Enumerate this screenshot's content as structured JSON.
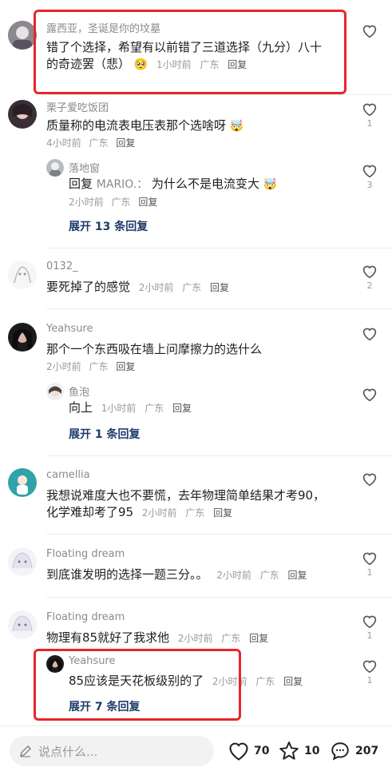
{
  "comments": [
    {
      "name": "露西亚，圣诞是你的坟墓",
      "text1": "错了个选择，希望有以前错了三道选择（九分）八十",
      "text2": "的奇迹罢（悲）",
      "emoji": "🥺",
      "time": "1小时前",
      "loc": "广东",
      "reply": "回复",
      "likes": ""
    },
    {
      "name": "栗子爱吃饭团",
      "text1": "质量称的电流表电压表那个选啥呀",
      "emoji": "🤯",
      "time": "4小时前",
      "loc": "广东",
      "reply": "回复",
      "likes": "1",
      "sub": {
        "name": "落地窗",
        "prefix": "回复",
        "target": "MARIO.：",
        "text": "为什么不是电流变大",
        "emoji": "🤯",
        "time": "2小时前",
        "loc": "广东",
        "reply": "回复",
        "likes": "3"
      },
      "expand": "展开 13 条回复"
    },
    {
      "name": "0132_",
      "text1": "要死掉了的感觉",
      "time": "2小时前",
      "loc": "广东",
      "reply": "回复",
      "likes": "2"
    },
    {
      "name": "Yeahsure",
      "text1": "那个一个东西吸在墙上问摩擦力的选什么",
      "time": "2小时前",
      "loc": "广东",
      "reply": "回复",
      "likes": "",
      "sub": {
        "name": "鱼泡",
        "text": "向上",
        "time": "1小时前",
        "loc": "广东",
        "reply": "回复",
        "likes": ""
      },
      "expand": "展开 1 条回复"
    },
    {
      "name": "camellia",
      "text1": "我想说难度大也不要慌，去年物理简单结果才考90，",
      "text2": "化学难却考了95",
      "time": "2小时前",
      "loc": "广东",
      "reply": "回复",
      "likes": ""
    },
    {
      "name": "Floating dream",
      "text1": "到底谁发明的选择一题三分。。",
      "time": "2小时前",
      "loc": "广东",
      "reply": "回复",
      "likes": "1"
    },
    {
      "name": "Floating dream",
      "text1": "物理有85就好了我求他",
      "time": "2小时前",
      "loc": "广东",
      "reply": "回复",
      "likes": "1",
      "sub": {
        "name": "Yeahsure",
        "text": "85应该是天花板级别的了",
        "time": "2小时前",
        "loc": "广东",
        "reply": "回复",
        "likes": "1"
      },
      "expand": "展开 7 条回复"
    }
  ],
  "footer": {
    "placeholder": "说点什么...",
    "likes": "70",
    "favorites": "10",
    "comments": "207"
  },
  "colors": {
    "highlight": "#e8262b",
    "link": "#1f3a6b"
  }
}
